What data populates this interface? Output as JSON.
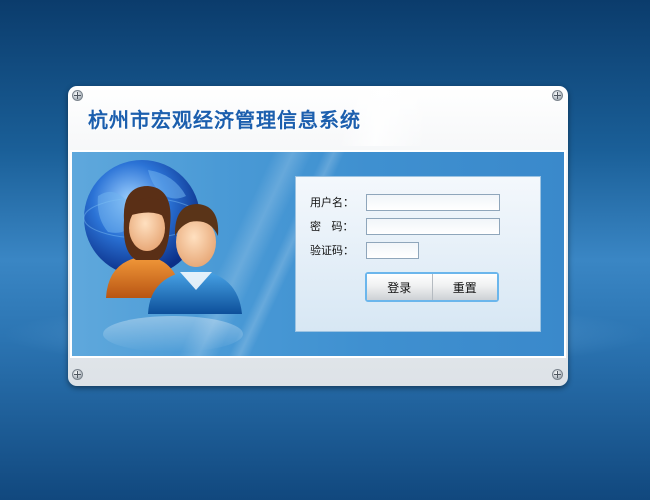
{
  "app": {
    "title": "杭州市宏观经济管理信息系统"
  },
  "login_form": {
    "username_label": "用户名：",
    "username_value": "",
    "password_label": "密   码：",
    "password_value": "",
    "captcha_label": "验证码：",
    "captcha_value": "",
    "login_button": "登录",
    "reset_button": "重置"
  },
  "colors": {
    "title_blue": "#1c5fae",
    "panel_blue": "#3f90d0",
    "page_background": "#1a5f98",
    "button_border": "#6bb6ec"
  },
  "icons": {
    "illustration": "users-globe-icon",
    "screws": "screw-icon"
  }
}
